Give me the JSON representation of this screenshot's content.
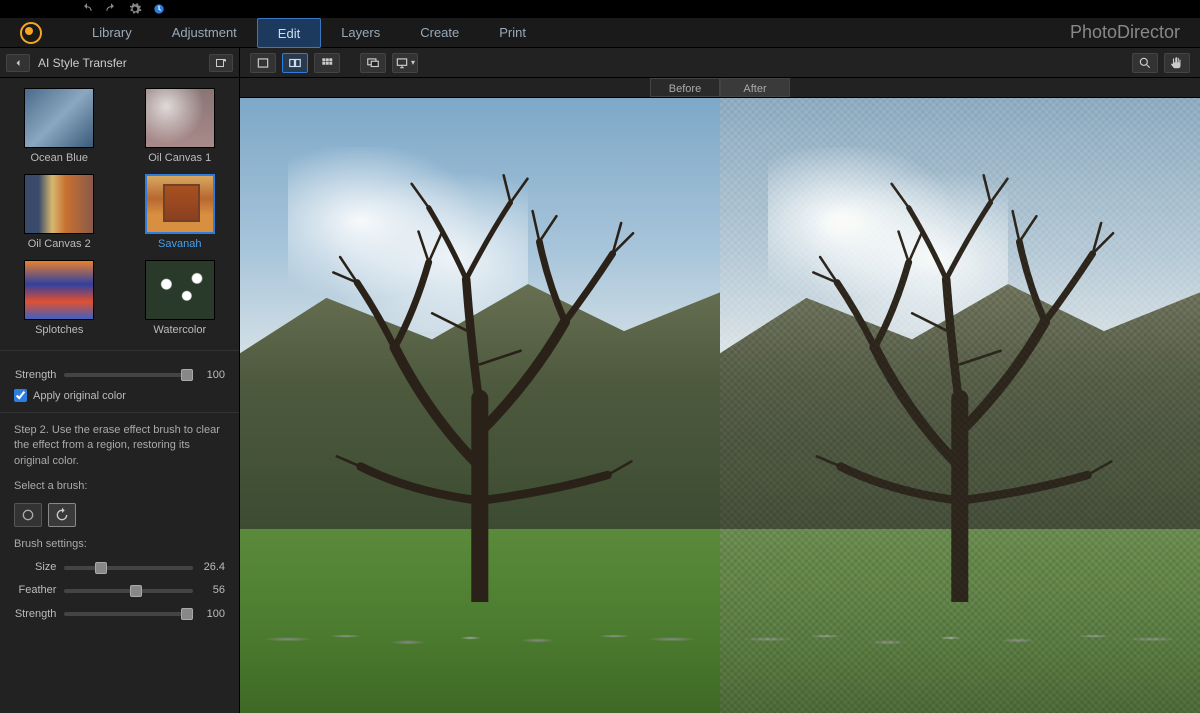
{
  "app": {
    "brand": "PhotoDirector"
  },
  "tabs": {
    "library": "Library",
    "adjustment": "Adjustment",
    "edit": "Edit",
    "layers": "Layers",
    "create": "Create",
    "print": "Print",
    "active": "edit"
  },
  "panel": {
    "title": "AI Style Transfer",
    "styles": [
      {
        "id": "ocean-blue",
        "label": "Ocean Blue"
      },
      {
        "id": "oil-canvas-1",
        "label": "Oil Canvas 1"
      },
      {
        "id": "oil-canvas-2",
        "label": "Oil Canvas 2"
      },
      {
        "id": "savanah",
        "label": "Savanah"
      },
      {
        "id": "splotches",
        "label": "Splotches"
      },
      {
        "id": "watercolor",
        "label": "Watercolor"
      }
    ],
    "selected_style": "savanah",
    "strength_label": "Strength",
    "strength_value": "100",
    "apply_original_label": "Apply original color",
    "apply_original_checked": true,
    "step2_text": "Step 2. Use the erase effect brush to clear the effect from a region, restoring its original color.",
    "select_brush_label": "Select a brush:",
    "brush_settings_label": "Brush settings:",
    "size_label": "Size",
    "size_value": "26.4",
    "feather_label": "Feather",
    "feather_value": "56",
    "brush_strength_label": "Strength",
    "brush_strength_value": "100"
  },
  "compare": {
    "before": "Before",
    "after": "After"
  }
}
